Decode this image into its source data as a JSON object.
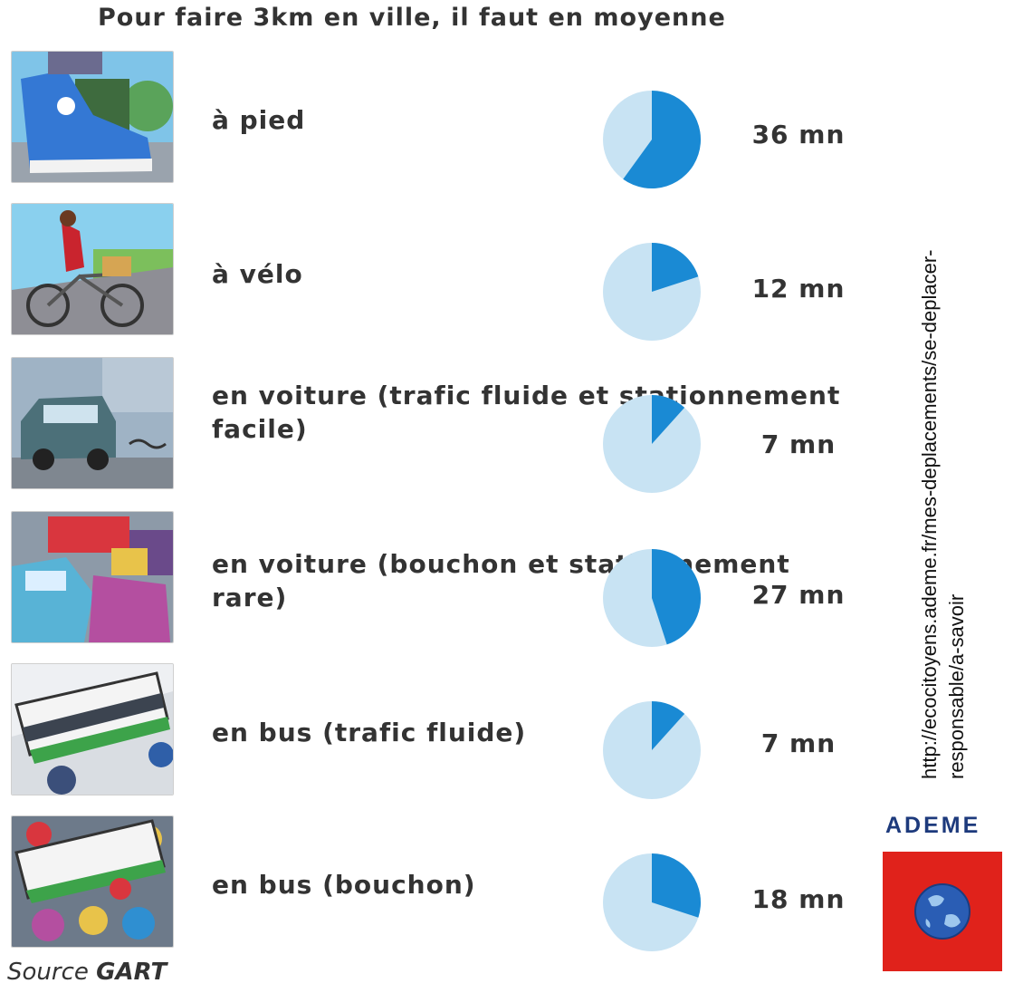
{
  "title": "Pour faire 3km en ville, il faut en moyenne",
  "source_prefix": "Source",
  "source_name": "GART",
  "url_text": "http://ecocitoyens.ademe.fr/mes-deplacements/se-deplacer-responsable/a-savoir",
  "logo_text": "ADEME",
  "colors": {
    "pie_fill": "#1a8ad4",
    "pie_bg": "#c8e3f3",
    "logo_red": "#e0221b",
    "logo_blue": "#1d3a7c"
  },
  "chart_data": {
    "type": "pie",
    "title": "Pour faire 3km en ville, il faut en moyenne",
    "unit": "mn",
    "max_minutes": 60,
    "categories": [
      "à pied",
      "à vélo",
      "en voiture (trafic fluide et stationnement facile)",
      "en voiture (bouchon et stationnement rare)",
      "en bus (trafic fluide)",
      "en bus (bouchon)"
    ],
    "values": [
      36,
      12,
      7,
      27,
      7,
      18
    ],
    "labels": [
      "36 mn",
      "12 mn",
      "7 mn",
      "27 mn",
      "7 mn",
      "18 mn"
    ]
  },
  "rows": [
    {
      "label": "à pied",
      "icon": "walking-shoe-illustration"
    },
    {
      "label": "à vélo",
      "icon": "cyclist-illustration"
    },
    {
      "label": "en voiture (trafic fluide et stationnement facile)",
      "icon": "car-illustration"
    },
    {
      "label": "en voiture (bouchon et stationnement rare)",
      "icon": "traffic-jam-illustration"
    },
    {
      "label": "en bus (trafic fluide)",
      "icon": "bus-illustration"
    },
    {
      "label": "en bus (bouchon)",
      "icon": "bus-jam-illustration"
    }
  ]
}
